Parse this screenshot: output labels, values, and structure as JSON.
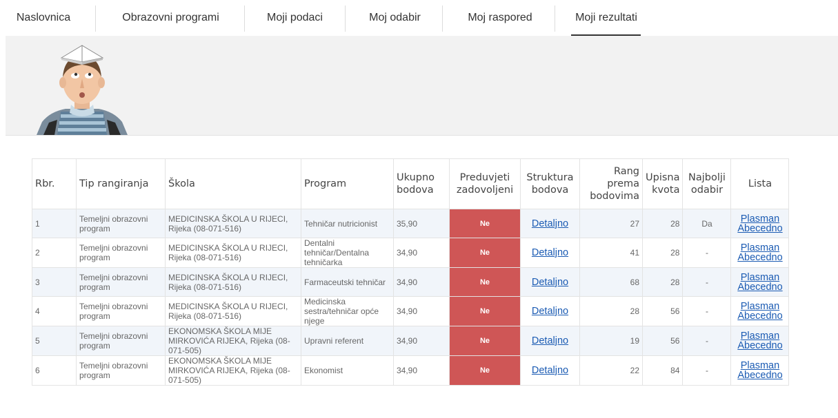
{
  "nav": {
    "items": [
      {
        "label": "Naslovnica"
      },
      {
        "label": "Obrazovni programi"
      },
      {
        "label": "Moji podaci"
      },
      {
        "label": "Moj odabir"
      },
      {
        "label": "Moj raspored"
      },
      {
        "label": "Moji rezultati"
      }
    ],
    "active": "Moji rezultati"
  },
  "table": {
    "headers": {
      "rbr": "Rbr.",
      "tip": "Tip rangiranja",
      "skola": "Škola",
      "program": "Program",
      "ukupno_1": "Ukupno",
      "ukupno_2": "bodova",
      "preduvjeti_1": "Preduvjeti",
      "preduvjeti_2": "zadovoljeni",
      "struktura_1": "Struktura",
      "struktura_2": "bodova",
      "rang_1": "Rang",
      "rang_2": "prema",
      "rang_3": "bodovima",
      "upisna_1": "Upisna",
      "upisna_2": "kvota",
      "najbolji_1": "Najbolji",
      "najbolji_2": "odabir",
      "lista": "Lista"
    },
    "rows": [
      {
        "rbr": "1",
        "tip": "Temeljni obrazovni program",
        "skola": "MEDICINSKA ŠKOLA U RIJECI, Rijeka (08-071-516)",
        "program": "Tehničar nutricionist",
        "ukupno": "35,90",
        "preduvjeti": "Ne",
        "struktura": "Detaljno",
        "rang": "27",
        "kvota": "28",
        "najbolji": "Da",
        "plasman": "Plasman",
        "abecedno": "Abecedno"
      },
      {
        "rbr": "2",
        "tip": "Temeljni obrazovni program",
        "skola": "MEDICINSKA ŠKOLA U RIJECI, Rijeka (08-071-516)",
        "program": "Dentalni tehničar/Dentalna tehničarka",
        "ukupno": "34,90",
        "preduvjeti": "Ne",
        "struktura": "Detaljno",
        "rang": "41",
        "kvota": "28",
        "najbolji": "-",
        "plasman": "Plasman",
        "abecedno": "Abecedno"
      },
      {
        "rbr": "3",
        "tip": "Temeljni obrazovni program",
        "skola": "MEDICINSKA ŠKOLA U RIJECI, Rijeka (08-071-516)",
        "program": "Farmaceutski tehničar",
        "ukupno": "34,90",
        "preduvjeti": "Ne",
        "struktura": "Detaljno",
        "rang": "68",
        "kvota": "28",
        "najbolji": "-",
        "plasman": "Plasman",
        "abecedno": "Abecedno"
      },
      {
        "rbr": "4",
        "tip": "Temeljni obrazovni program",
        "skola": "MEDICINSKA ŠKOLA U RIJECI, Rijeka (08-071-516)",
        "program": "Medicinska sestra/tehničar opće njege",
        "ukupno": "34,90",
        "preduvjeti": "Ne",
        "struktura": "Detaljno",
        "rang": "28",
        "kvota": "56",
        "najbolji": "-",
        "plasman": "Plasman",
        "abecedno": "Abecedno"
      },
      {
        "rbr": "5",
        "tip": "Temeljni obrazovni program",
        "skola": "EKONOMSKA ŠKOLA MIJE MIRKOVIĆA RIJEKA, Rijeka (08-071-505)",
        "program": "Upravni referent",
        "ukupno": "34,90",
        "preduvjeti": "Ne",
        "struktura": "Detaljno",
        "rang": "19",
        "kvota": "56",
        "najbolji": "-",
        "plasman": "Plasman",
        "abecedno": "Abecedno"
      },
      {
        "rbr": "6",
        "tip": "Temeljni obrazovni program",
        "skola": "EKONOMSKA ŠKOLA MIJE MIRKOVIĆA RIJEKA, Rijeka (08-071-505)",
        "program": "Ekonomist",
        "ukupno": "34,90",
        "preduvjeti": "Ne",
        "struktura": "Detaljno",
        "rang": "22",
        "kvota": "84",
        "najbolji": "-",
        "plasman": "Plasman",
        "abecedno": "Abecedno"
      }
    ]
  },
  "colors": {
    "ne_cell": "#cf5656",
    "link": "#1b5bb3",
    "row_alt": "#f1f5fa",
    "banner": "#f2f2f2"
  }
}
